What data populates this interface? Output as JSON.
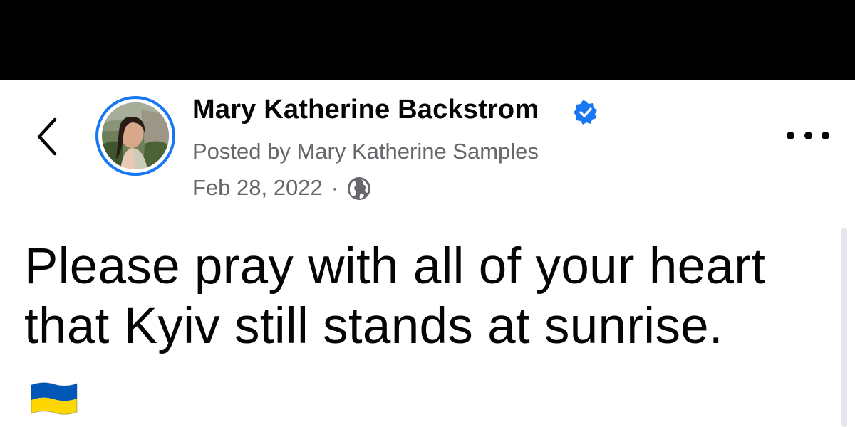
{
  "post": {
    "author_name": "Mary Katherine Backstrom",
    "posted_by": "Posted by Mary Katherine Samples",
    "date": "Feb 28, 2022",
    "separator": "·",
    "text": "Please pray with all of your heart that Kyiv still stands at sunrise."
  },
  "icons": {
    "back": "chevron-left-icon",
    "verified": "verified-badge-icon",
    "audience": "globe-icon",
    "more": "more-options-icon",
    "emoji": "ukraine-flag-emoji"
  },
  "colors": {
    "top_bar": "#000000",
    "avatar_ring": "#1877f2",
    "verified_badge": "#1877f2",
    "secondary_text": "#65676b",
    "flag_blue": "#0057b7",
    "flag_yellow": "#ffd700"
  }
}
